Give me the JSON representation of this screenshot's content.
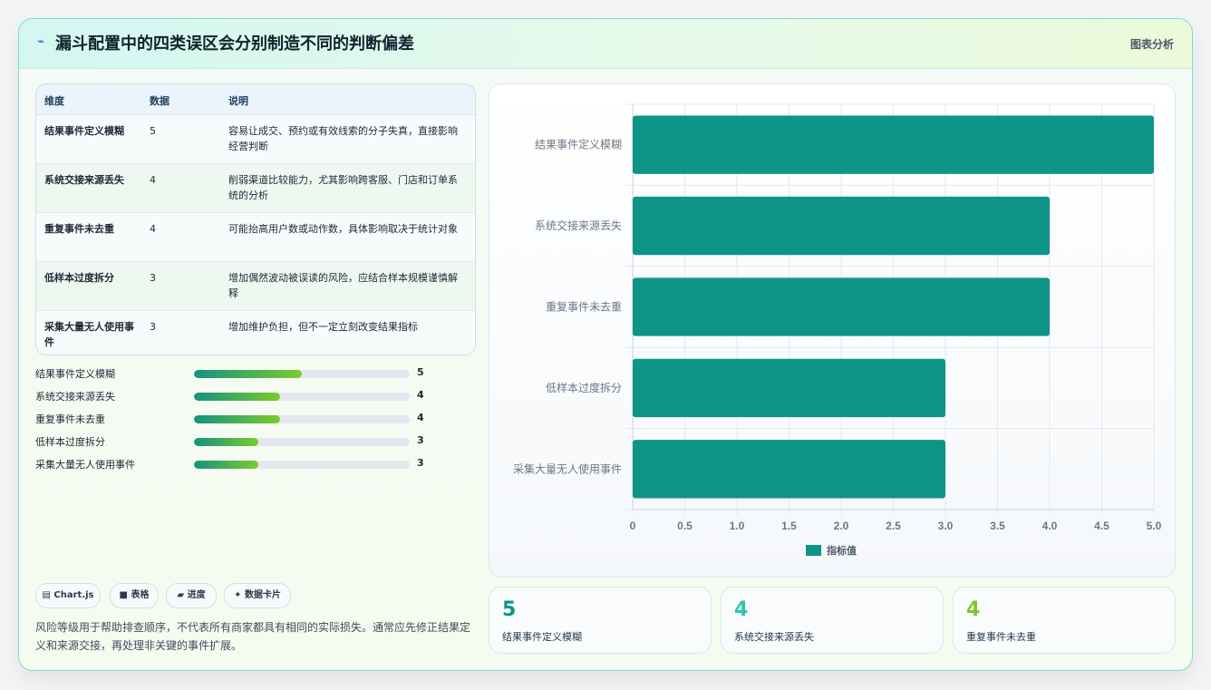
{
  "header": {
    "icon": "bolt-icon",
    "title": "漏斗配置中的四类误区会分别制造不同的判断偏差",
    "tag": "图表分析"
  },
  "table": {
    "columns": [
      "维度",
      "数据",
      "说明"
    ],
    "rows": [
      {
        "name": "结果事件定义模糊",
        "value": "5",
        "desc": "容易让成交、预约或有效线索的分子失真，直接影响经营判断"
      },
      {
        "name": "系统交接来源丢失",
        "value": "4",
        "desc": "削弱渠道比较能力，尤其影响跨客服、门店和订单系统的分析"
      },
      {
        "name": "重复事件未去重",
        "value": "4",
        "desc": "可能抬高用户数或动作数，具体影响取决于统计对象"
      },
      {
        "name": "低样本过度拆分",
        "value": "3",
        "desc": "增加偶然波动被误读的风险，应结合样本规模谨慎解释"
      },
      {
        "name": "采集大量无人使用事件",
        "value": "3",
        "desc": "增加维护负担，但不一定立刻改变结果指标"
      }
    ]
  },
  "progress": {
    "max": 10,
    "items": [
      {
        "label": "结果事件定义模糊",
        "value": 5,
        "display": "5"
      },
      {
        "label": "系统交接来源丢失",
        "value": 4,
        "display": "4"
      },
      {
        "label": "重复事件未去重",
        "value": 4,
        "display": "4"
      },
      {
        "label": "低样本过度拆分",
        "value": 3,
        "display": "3"
      },
      {
        "label": "采集大量无人使用事件",
        "value": 3,
        "display": "3"
      }
    ]
  },
  "chips": [
    {
      "icon": "chart-icon",
      "glyph": "▤",
      "label": "Chart.js"
    },
    {
      "icon": "table-icon",
      "glyph": "■",
      "label": "表格"
    },
    {
      "icon": "progress-icon",
      "glyph": "▰",
      "label": "进度"
    },
    {
      "icon": "sparkle-icon",
      "glyph": "✦",
      "label": "数据卡片"
    }
  ],
  "note": "风险等级用于帮助排查顺序，不代表所有商家都具有相同的实际损失。通常应先修正结果定义和来源交接，再处理非关键的事件扩展。",
  "chart_data": {
    "type": "bar",
    "orientation": "horizontal",
    "categories": [
      "结果事件定义模糊",
      "系统交接来源丢失",
      "重复事件未去重",
      "低样本过度拆分",
      "采集大量无人使用事件"
    ],
    "series": [
      {
        "name": "指标值",
        "values": [
          5,
          4,
          4,
          3,
          3
        ],
        "color": "#0f9488"
      }
    ],
    "xlim": [
      0,
      5
    ],
    "xticks": [
      "0",
      "0.5",
      "1.0",
      "1.5",
      "2.0",
      "2.5",
      "3.0",
      "3.5",
      "4.0",
      "4.5",
      "5.0"
    ],
    "grid": true,
    "legend": "bottom"
  },
  "kpis": [
    {
      "value": "5",
      "label": "结果事件定义模糊",
      "color": "#0f9488"
    },
    {
      "value": "4",
      "label": "系统交接来源丢失",
      "color": "#2ec4b0"
    },
    {
      "value": "4",
      "label": "重复事件未去重",
      "color": "#7cc62d"
    }
  ]
}
